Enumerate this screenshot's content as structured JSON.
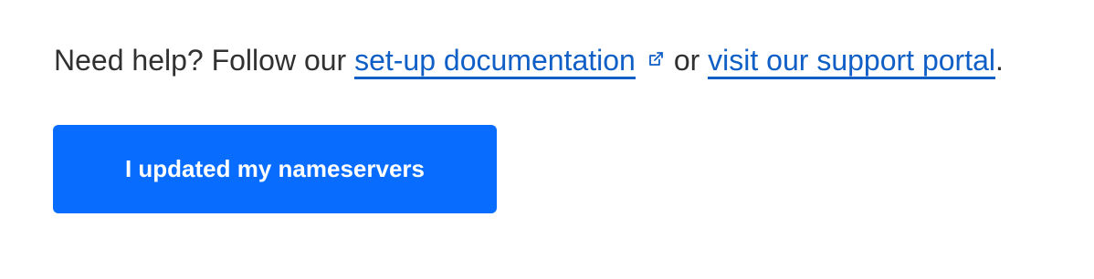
{
  "help": {
    "prefix": "Need help? Follow our ",
    "docs_link": "set-up documentation",
    "docs_icon": "external-link-icon",
    "middle": "or ",
    "support_link": "visit our support portal",
    "suffix": "."
  },
  "actions": {
    "confirm_button": "I updated my nameservers"
  },
  "colors": {
    "link": "#0f5fc6",
    "button_bg": "#086dff",
    "button_text": "#ffffff",
    "body_text": "#313131"
  }
}
